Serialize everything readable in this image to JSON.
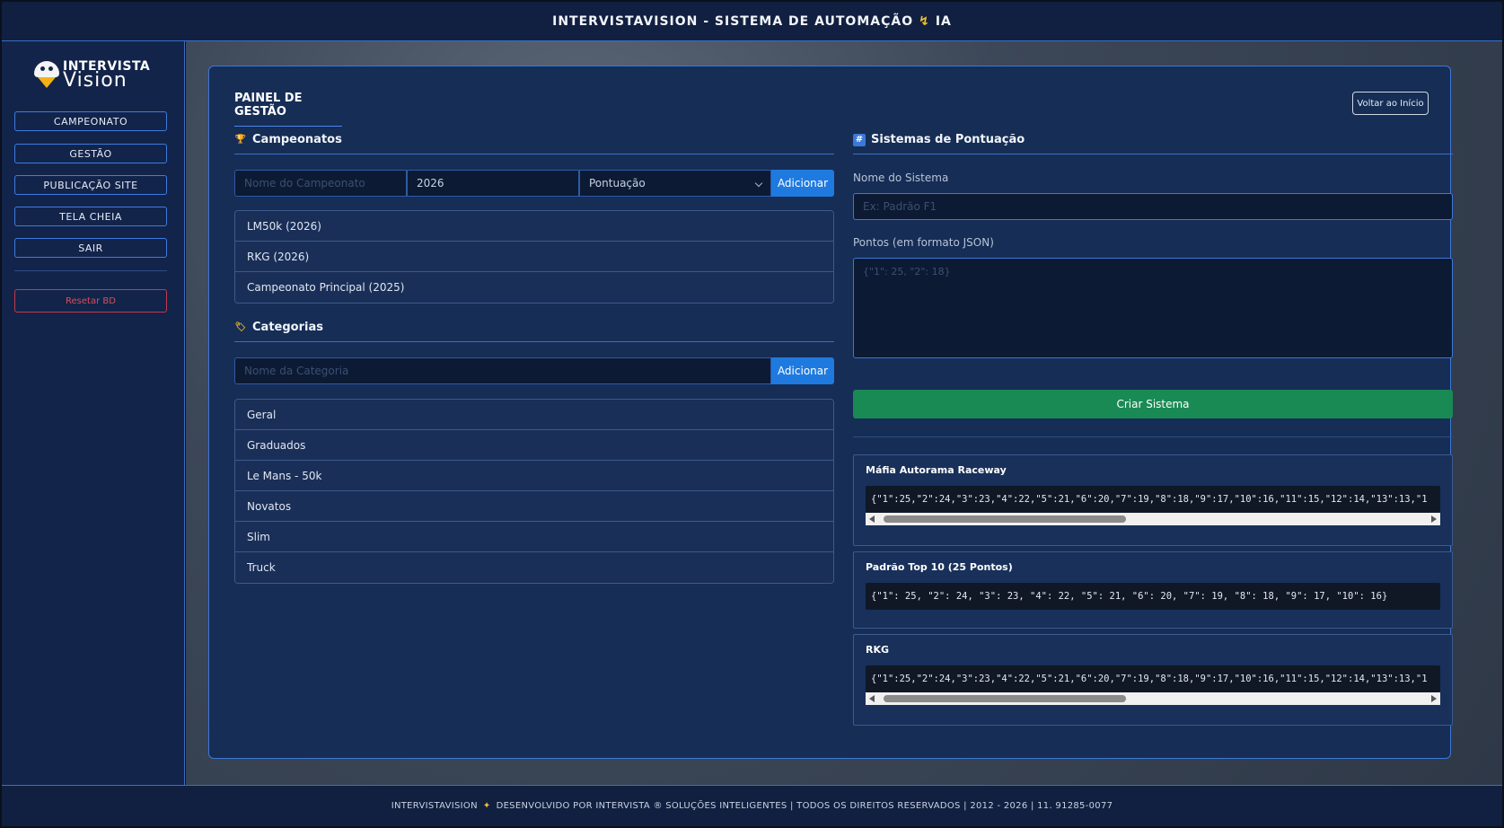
{
  "header": {
    "title_left": "INTERVISTAVISION - SISTEMA DE AUTOMAÇÃO",
    "title_right": "IA"
  },
  "logo": {
    "line1": "INTERVISTA",
    "line2": "Vision"
  },
  "sidebar": {
    "items": [
      {
        "label": "CAMPEONATO"
      },
      {
        "label": "GESTÃO"
      },
      {
        "label": "PUBLICAÇÃO SITE"
      },
      {
        "label": "TELA CHEIA"
      },
      {
        "label": "SAIR"
      }
    ],
    "reset_label": "Resetar BD"
  },
  "panel": {
    "title": "PAINEL DE GESTÃO",
    "back_label": "Voltar ao Início"
  },
  "championships": {
    "heading": "Campeonatos",
    "name_placeholder": "Nome do Campeonato",
    "year_value": "2026",
    "scoring_value": "Pontuação",
    "add_label": "Adicionar",
    "items": [
      "LM50k (2026)",
      "RKG (2026)",
      "Campeonato Principal (2025)"
    ]
  },
  "categories": {
    "heading": "Categorias",
    "name_placeholder": "Nome da Categoria",
    "add_label": "Adicionar",
    "items": [
      "Geral",
      "Graduados",
      "Le Mans - 50k",
      "Novatos",
      "Slim",
      "Truck"
    ]
  },
  "scoring": {
    "heading": "Sistemas de Pontuação",
    "name_label": "Nome do Sistema",
    "name_placeholder": "Ex: Padrão F1",
    "points_label": "Pontos (em formato JSON)",
    "points_placeholder": "{\"1\": 25, \"2\": 18}",
    "create_label": "Criar Sistema",
    "systems": [
      {
        "name": "Máfia Autorama Raceway",
        "json": "{\"1\":25,\"2\":24,\"3\":23,\"4\":22,\"5\":21,\"6\":20,\"7\":19,\"8\":18,\"9\":17,\"10\":16,\"11\":15,\"12\":14,\"13\":13,\"1"
      },
      {
        "name": "Padrão Top 10 (25 Pontos)",
        "json": "{\"1\": 25, \"2\": 24, \"3\": 23, \"4\": 22, \"5\": 21, \"6\": 20, \"7\": 19, \"8\": 18, \"9\": 17, \"10\": 16}"
      },
      {
        "name": "RKG",
        "json": "{\"1\":25,\"2\":24,\"3\":23,\"4\":22,\"5\":21,\"6\":20,\"7\":19,\"8\":18,\"9\":17,\"10\":16,\"11\":15,\"12\":14,\"13\":13,\"1"
      }
    ]
  },
  "footer": {
    "left": "INTERVISTAVISION",
    "right": "DESENVOLVIDO POR INTERVISTA ® SOLUÇÕES INTELIGENTES | TODOS OS DIREITOS RESERVADOS | 2012 - 2026 | 11. 91285-0077"
  },
  "colors": {
    "accent": "#1f7ae0",
    "success": "#1a8a55",
    "danger": "#c0394a",
    "panel": "#162d55"
  }
}
